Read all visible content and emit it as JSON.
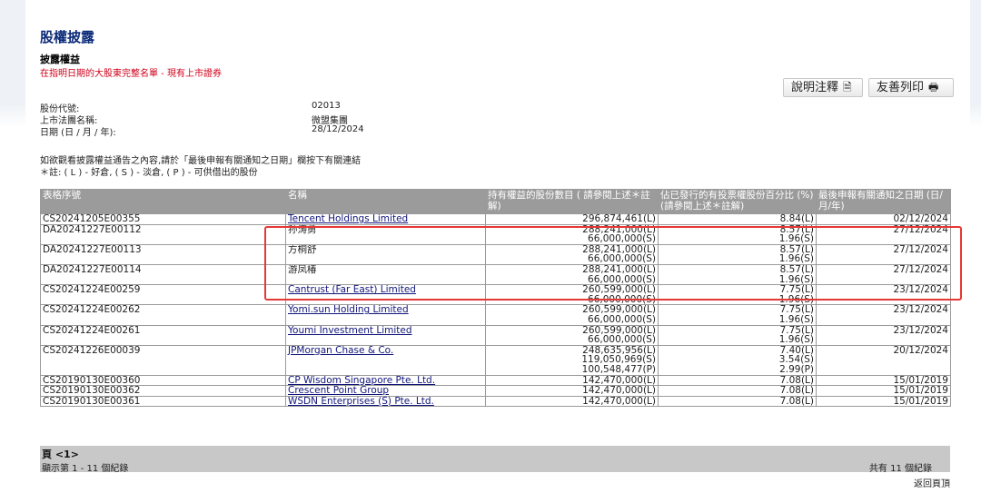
{
  "header": {
    "title": "股權披露",
    "subtitle": "披露權益",
    "description": "在指明日期的大股東完整名單 - 現有上市證券"
  },
  "toolbar": {
    "notes_label": "說明注釋",
    "print_label": "友善列印"
  },
  "meta": [
    {
      "label": "股份代號:",
      "value": "02013"
    },
    {
      "label": "上市法團名稱:",
      "value": "微盟集團"
    },
    {
      "label": "日期 (日 / 月 / 年):",
      "value": "28/12/2024"
    }
  ],
  "info": {
    "line1": "如欲觀看披露權益通告之內容,請於「最後申報有關通知之日期」欄按下有關連結",
    "line2": "＊註: ( L ) - 好倉, ( S ) - 淡倉, ( P ) - 可供借出的股份"
  },
  "table": {
    "headers": [
      "表格序號",
      "名稱",
      "持有權益的股份數目 ( 請參閱上述＊註解)",
      "佔已發行的有投票權股份百分比 (%) (請參閱上述＊註解)",
      "最後申報有關通知之日期 (日/月/年)"
    ],
    "rows": [
      {
        "serial": "CS20241205E00355",
        "name": "Tencent Holdings Limited",
        "shares": [
          "296,874,461(L)"
        ],
        "pct": [
          "8.84(L)"
        ],
        "date": "02/12/2024"
      },
      {
        "serial": "DA20241227E00112",
        "name": "孙涛勇",
        "shares": [
          "288,241,000(L)",
          "66,000,000(S)"
        ],
        "pct": [
          "8.57(L)",
          "1.96(S)"
        ],
        "date": "27/12/2024"
      },
      {
        "serial": "DA20241227E00113",
        "name": "方桐舒",
        "shares": [
          "288,241,000(L)",
          "66,000,000(S)"
        ],
        "pct": [
          "8.57(L)",
          "1.96(S)"
        ],
        "date": "27/12/2024"
      },
      {
        "serial": "DA20241227E00114",
        "name": "游凤椿",
        "shares": [
          "288,241,000(L)",
          "66,000,000(S)"
        ],
        "pct": [
          "8.57(L)",
          "1.96(S)"
        ],
        "date": "27/12/2024"
      },
      {
        "serial": "CS20241224E00259",
        "name": "Cantrust (Far East) Limited",
        "shares": [
          "260,599,000(L)",
          "66,000,000(S)"
        ],
        "pct": [
          "7.75(L)",
          "1.96(S)"
        ],
        "date": "23/12/2024"
      },
      {
        "serial": "CS20241224E00262",
        "name": "Yomi.sun Holding Limited",
        "shares": [
          "260,599,000(L)",
          "66,000,000(S)"
        ],
        "pct": [
          "7.75(L)",
          "1.96(S)"
        ],
        "date": "23/12/2024"
      },
      {
        "serial": "CS20241224E00261",
        "name": "Youmi Investment Limited",
        "shares": [
          "260,599,000(L)",
          "66,000,000(S)"
        ],
        "pct": [
          "7.75(L)",
          "1.96(S)"
        ],
        "date": "23/12/2024"
      },
      {
        "serial": "CS20241226E00039",
        "name": "JPMorgan Chase & Co.",
        "shares": [
          "248,635,956(L)",
          "119,050,969(S)",
          "100,548,477(P)"
        ],
        "pct": [
          "7.40(L)",
          "3.54(S)",
          "2.99(P)"
        ],
        "date": "20/12/2024"
      },
      {
        "serial": "CS20190130E00360",
        "name": "CP Wisdom Singapore Pte. Ltd.",
        "shares": [
          "142,470,000(L)"
        ],
        "pct": [
          "7.08(L)"
        ],
        "date": "15/01/2019"
      },
      {
        "serial": "CS20190130E00362",
        "name": "Crescent Point Group",
        "shares": [
          "142,470,000(L)"
        ],
        "pct": [
          "7.08(L)"
        ],
        "date": "15/01/2019"
      },
      {
        "serial": "CS20190130E00361",
        "name": "WSDN Enterprises (S) Pte. Ltd.",
        "shares": [
          "142,470,000(L)"
        ],
        "pct": [
          "7.08(L)"
        ],
        "date": "15/01/2019"
      }
    ]
  },
  "footer": {
    "pager": "頁 <1>",
    "showing": "顯示第 1 - 11 個紀錄",
    "total": "共有 11 個紀錄",
    "back_to_top": "返回頁頂"
  },
  "colors": {
    "title": "#0b2a78",
    "alert": "#d0021b",
    "header_bg": "#9b9b9b",
    "highlight": "#e53935"
  },
  "icons": {
    "notes": "document-icon",
    "print": "printer-icon"
  }
}
